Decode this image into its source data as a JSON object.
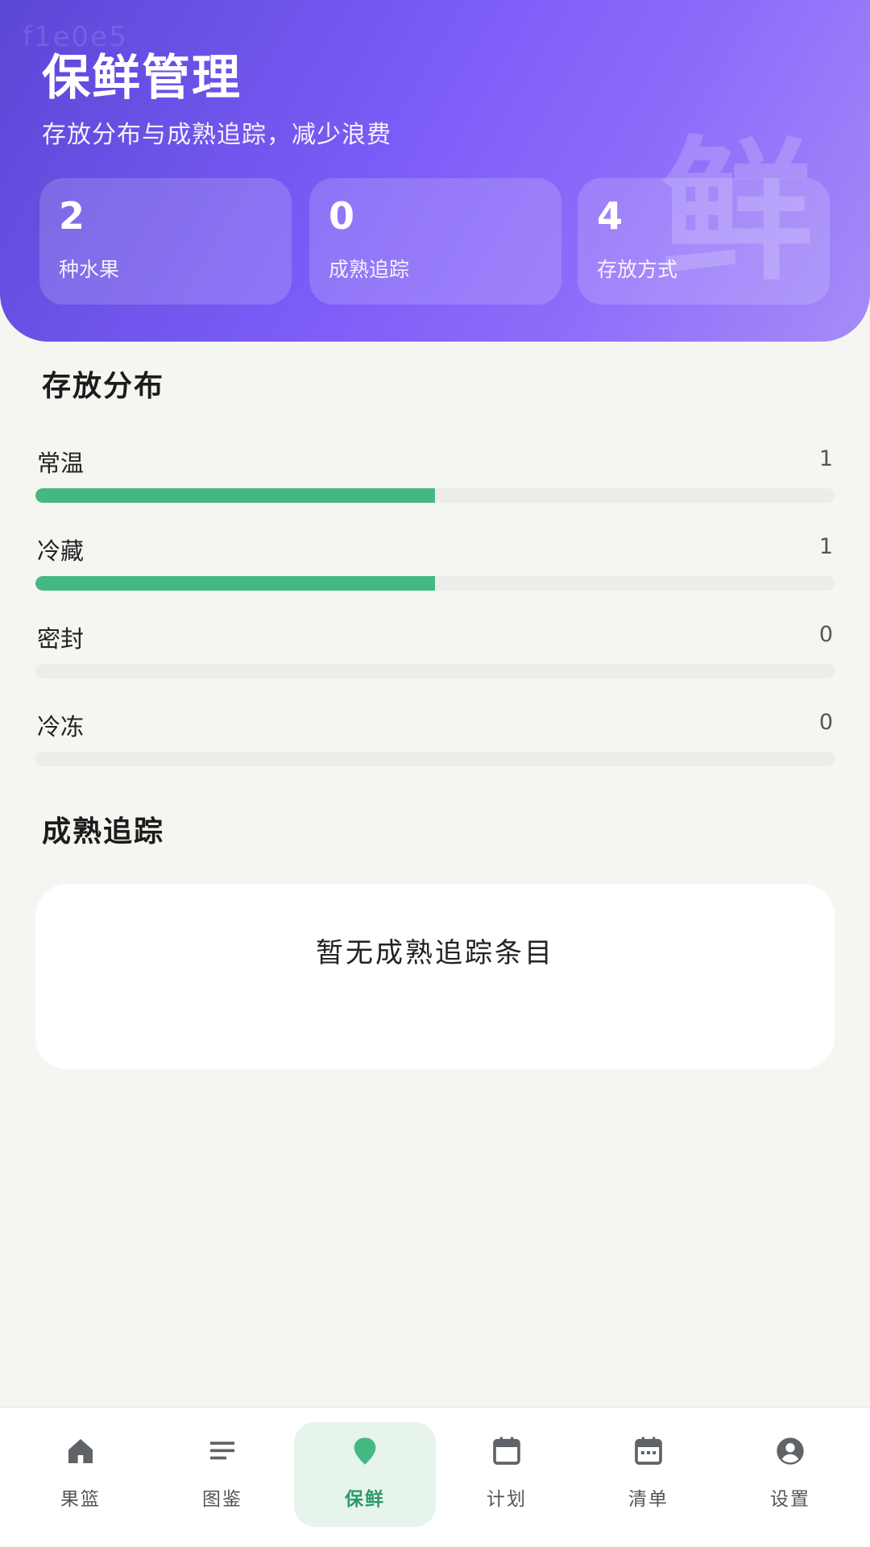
{
  "header": {
    "watermark": "f1e0e5",
    "watermark_char": "鲜",
    "title": "保鲜管理",
    "subtitle": "存放分布与成熟追踪，减少浪费",
    "stats": [
      {
        "value": "2",
        "label": "种水果"
      },
      {
        "value": "0",
        "label": "成熟追踪"
      },
      {
        "value": "4",
        "label": "存放方式"
      }
    ]
  },
  "storage": {
    "title": "存放分布",
    "rows": [
      {
        "label": "常温",
        "count": "1",
        "fraction": 0.5
      },
      {
        "label": "冷藏",
        "count": "1",
        "fraction": 0.5
      },
      {
        "label": "密封",
        "count": "0",
        "fraction": 0
      },
      {
        "label": "冷冻",
        "count": "0",
        "fraction": 0
      }
    ]
  },
  "ripeness": {
    "title": "成熟追踪",
    "empty_text": "暂无成熟追踪条目"
  },
  "nav": {
    "items": [
      {
        "label": "果篮",
        "icon": "home-icon"
      },
      {
        "label": "图鉴",
        "icon": "list-icon"
      },
      {
        "label": "保鲜",
        "icon": "leaf-icon",
        "active": true
      },
      {
        "label": "计划",
        "icon": "calendar-icon"
      },
      {
        "label": "清单",
        "icon": "calendar-grid-icon"
      },
      {
        "label": "设置",
        "icon": "account-icon"
      }
    ]
  },
  "colors": {
    "accent_green": "#43b883",
    "active_nav_text": "#2d9a63",
    "header_purple": "#7c5cf7"
  }
}
